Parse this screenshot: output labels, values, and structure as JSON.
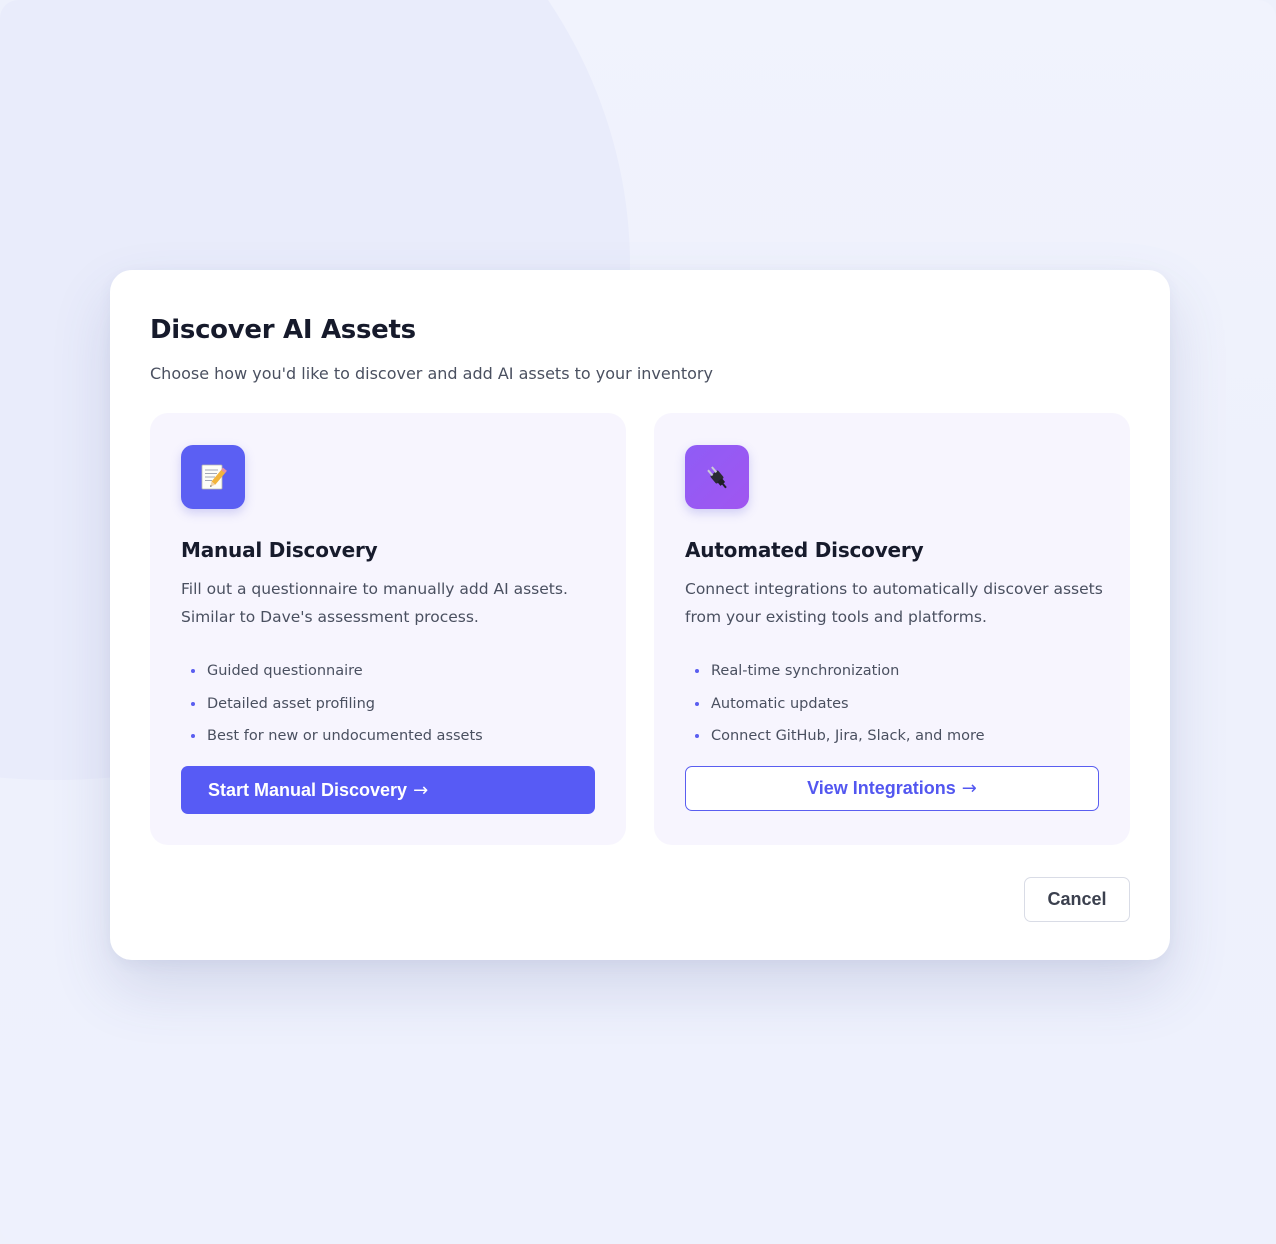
{
  "modal": {
    "title": "Discover AI Assets",
    "subtitle": "Choose how you'd like to discover and add AI assets to your inventory",
    "cancel_label": "Cancel"
  },
  "cards": {
    "manual": {
      "icon": "memo-icon",
      "title": "Manual Discovery",
      "description_line1": "Fill out a questionnaire to manually add AI assets.",
      "description_line2": "Similar to Dave's assessment process.",
      "features": [
        "Guided questionnaire",
        "Detailed asset profiling",
        "Best for new or undocumented assets"
      ],
      "button_label": "Start Manual Discovery",
      "button_arrow": "→"
    },
    "automated": {
      "icon": "plug-icon",
      "title": "Automated Discovery",
      "description_line1": "Connect integrations to automatically discover assets",
      "description_line2": "from your existing tools and platforms.",
      "features": [
        "Real-time synchronization",
        "Automatic updates",
        "Connect GitHub, Jira, Slack, and more"
      ],
      "button_label": "View Integrations",
      "button_arrow": "→"
    }
  },
  "colors": {
    "accent": "#575bf5",
    "accent_purple": "#9659f3",
    "card_bg": "#f7f5fe",
    "page_bg": "#eef1fc"
  }
}
